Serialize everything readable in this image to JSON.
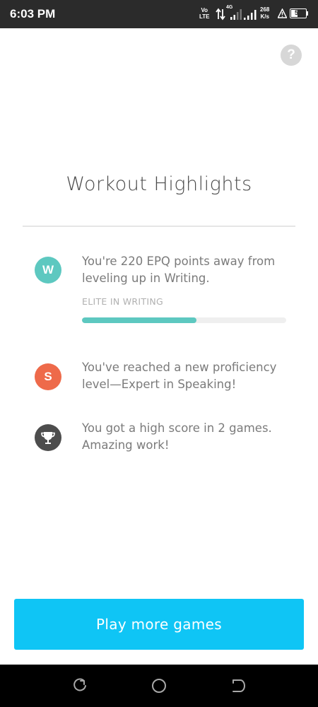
{
  "status_bar": {
    "time": "6:03 PM",
    "volte": [
      "Vo",
      "LTE"
    ],
    "network": "4G",
    "speed": [
      "268",
      "K/s"
    ],
    "battery": "52",
    "battery_level": 0.52
  },
  "icons": {
    "help": "?",
    "writing": "W",
    "speaking": "S"
  },
  "title": "Workout Highlights",
  "highlights": [
    {
      "icon": "W",
      "text": "You're 220 EPQ points away from leveling up in Writing.",
      "sublabel": "ELITE IN WRITING",
      "progress": 0.56,
      "color": "#5dc8c0"
    },
    {
      "icon": "S",
      "text": "You've reached a new proficiency level—Expert in Speaking!",
      "color": "#ee6a4a"
    },
    {
      "icon": "trophy-icon",
      "text": "You got a high score in 2 games. Amazing work!",
      "color": "#4d4d4d"
    }
  ],
  "cta": {
    "label": "Play more games",
    "color": "#0fc5f5"
  }
}
